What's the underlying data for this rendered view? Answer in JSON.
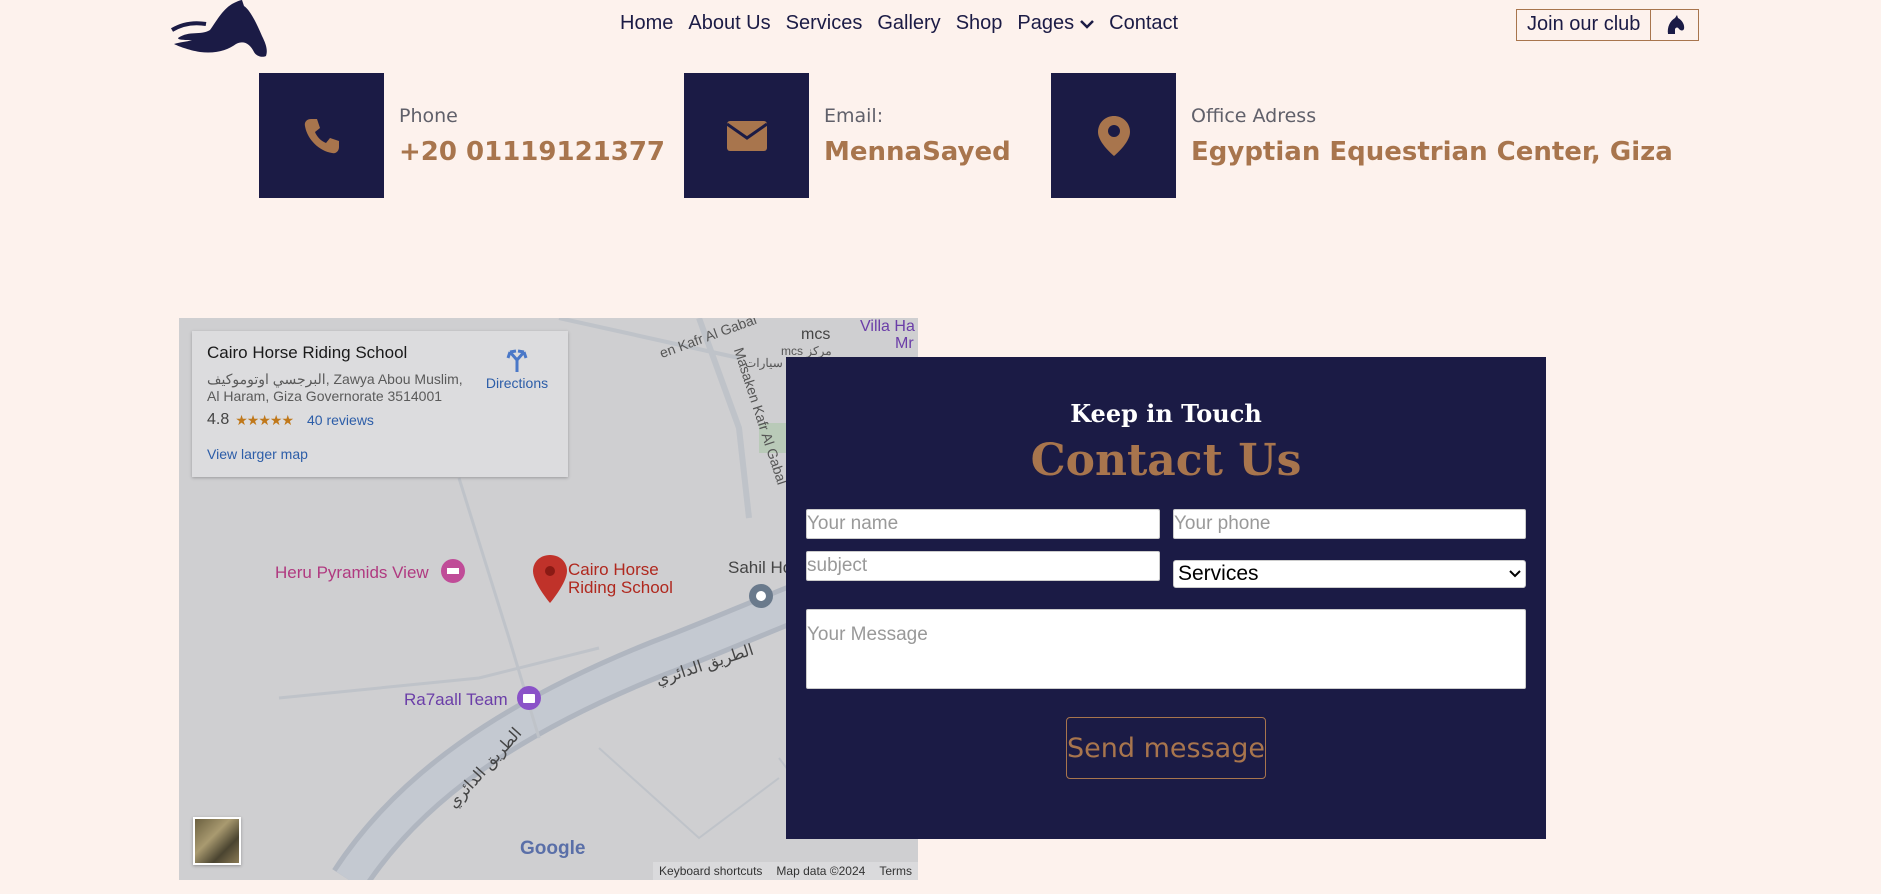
{
  "nav": {
    "items": [
      "Home",
      "About Us",
      "Services",
      "Gallery",
      "Shop",
      "Pages",
      "Contact"
    ],
    "join_label": "Join our club"
  },
  "info": [
    {
      "label": "Phone",
      "value": "+20 01119121377",
      "icon": "phone-icon"
    },
    {
      "label": "Email:",
      "value": "MennaSayed",
      "icon": "envelope-icon"
    },
    {
      "label": "Office Adress",
      "value": "Egyptian Equestrian Center, Giza",
      "icon": "location-pin-icon"
    }
  ],
  "map": {
    "place": "Cairo Horse Riding School",
    "address": "البرجسي اوتوموكيف, Zawya Abou Muslim, Al Haram, Giza Governorate 3514001",
    "rating": "4.8",
    "stars": "★★★★★",
    "reviews": "40 reviews",
    "directions": "Directions",
    "view_larger": "View larger map",
    "labels": {
      "pin": "Cairo Horse\nRiding School",
      "heru": "Heru Pyramids View",
      "ra7aal": "Ra7aall Team",
      "sahil": "Sahil Ho",
      "kafr1": "Masaken Kafr Al Gabal",
      "kafr2": "en Kafr Al Gabal",
      "mcs": "mcs",
      "mcs_sub": "mcs مركز",
      "sayarat": "سيارات",
      "villa": "Villa Ha",
      "villa2": "Mr",
      "ring1": "الطريق الدائري",
      "ring2": "الطريق الدائري"
    },
    "google": "Google",
    "footer": [
      "Keyboard shortcuts",
      "Map data ©2024",
      "Terms"
    ]
  },
  "form": {
    "subtitle": "Keep in Touch",
    "title": "Contact Us",
    "name_placeholder": "Your name",
    "phone_placeholder": "Your phone",
    "subject_placeholder": "subject",
    "service_selected": "Services",
    "message_placeholder": "Your Message",
    "send_label": "Send message"
  },
  "colors": {
    "navy": "#1b1b45",
    "accent": "#a8754d",
    "background": "#fdf2ed"
  }
}
